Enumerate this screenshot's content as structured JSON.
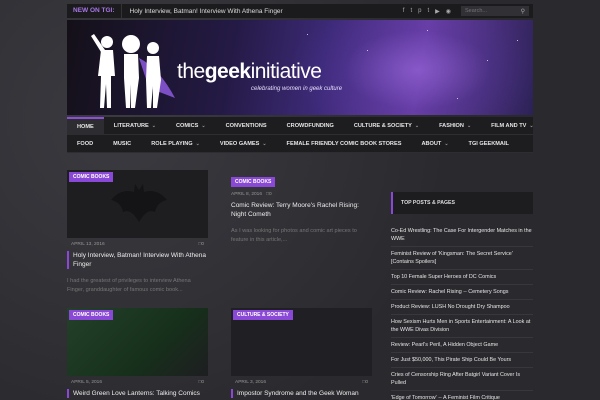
{
  "topbar": {
    "badge": "NEW ON TGI:",
    "ticker": "Holy Interview, Batman! Interview With Athena Finger",
    "social_icons": [
      "facebook-icon",
      "twitter-icon",
      "pinterest-icon",
      "tumblr-icon",
      "youtube-icon",
      "rss-icon"
    ],
    "social_glyphs": [
      "f",
      "t",
      "p",
      "t",
      "▶",
      "◉"
    ],
    "search_placeholder": "Search..."
  },
  "brand": {
    "name_light": "the",
    "name_bold": "geek",
    "name_light2": "initiative",
    "tagline": "celebrating women in geek culture"
  },
  "nav": {
    "row1": [
      {
        "label": "HOME",
        "dropdown": false,
        "active": true
      },
      {
        "label": "LITERATURE",
        "dropdown": true
      },
      {
        "label": "COMICS",
        "dropdown": true
      },
      {
        "label": "CONVENTIONS",
        "dropdown": false
      },
      {
        "label": "CROWDFUNDING",
        "dropdown": false
      },
      {
        "label": "CULTURE & SOCIETY",
        "dropdown": true
      },
      {
        "label": "FASHION",
        "dropdown": true
      },
      {
        "label": "FILM AND TV",
        "dropdown": true
      }
    ],
    "row2": [
      {
        "label": "FOOD",
        "dropdown": false
      },
      {
        "label": "MUSIC",
        "dropdown": false
      },
      {
        "label": "ROLE PLAYING",
        "dropdown": true
      },
      {
        "label": "VIDEO GAMES",
        "dropdown": true
      },
      {
        "label": "FEMALE FRIENDLY COMIC BOOK STORES",
        "dropdown": false
      },
      {
        "label": "ABOUT",
        "dropdown": true
      },
      {
        "label": "TGI GEEKMAIL",
        "dropdown": false
      }
    ]
  },
  "posts": [
    {
      "category": "COMIC BOOKS",
      "date": "APRIL 13, 2016",
      "comments": "0",
      "title": "Holy Interview, Batman! Interview With Athena Finger",
      "excerpt": "I had the greatest of privileges to interview Athena Finger, granddaughter of famous comic book..."
    },
    {
      "category": "COMIC BOOKS",
      "date": "APRIL 8, 2016",
      "comments": "0",
      "title": "Comic Review: Terry Moore's Rachel Rising: Night Cometh",
      "excerpt": "As I was looking for photos and comic art pieces to feature in this article,..."
    },
    {
      "category": "COMIC BOOKS",
      "date": "APRIL 5, 2016",
      "comments": "0",
      "title": "Weird Green Love Lanterns: Talking Comics",
      "excerpt": ""
    },
    {
      "category": "CULTURE & SOCIETY",
      "date": "APRIL 3, 2016",
      "comments": "0",
      "title": "Impostor Syndrome and the Geek Woman",
      "excerpt": ""
    }
  ],
  "sidebar": {
    "heading": "TOP POSTS & PAGES",
    "items": [
      "Co-Ed Wrestling: The Case For Intergender Matches in the WWE",
      "Feminist Review of 'Kingsman: The Secret Service' [Contains Spoilers]",
      "Top 10 Female Super Heroes of DC Comics",
      "Comic Review: Rachel Rising -- Cemetery Songs",
      "Product Review: LUSH No Drought Dry Shampoo",
      "How Sexism Hurts Men in Sports Entertainment: A Look at the WWE Divas Division",
      "Review: Pearl's Peril, A Hidden Object Game",
      "For Just $50,000, This Pirate Ship Could Be Yours",
      "Cries of Censorship Ring After Batgirl Variant Cover Is Pulled",
      "'Edge of Tomorrow' -- A Feminist Film Critique"
    ]
  },
  "colors": {
    "accent": "#8a48d6",
    "background": "#2a2a2e",
    "panel": "#1d1d20"
  }
}
